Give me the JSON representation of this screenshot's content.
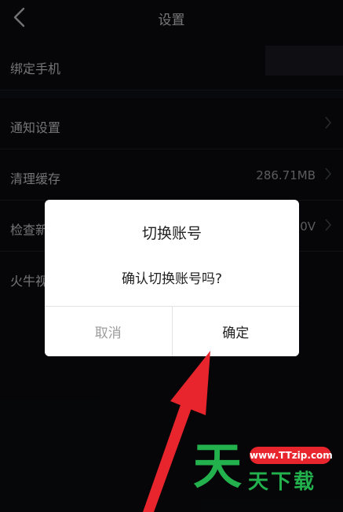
{
  "header": {
    "title": "设置",
    "back_icon": "chevron-left-icon"
  },
  "settings": {
    "items": [
      {
        "label": "绑定手机",
        "value": ""
      },
      {
        "label": "通知设置",
        "value": ""
      },
      {
        "label": "清理缓存",
        "value": "286.71MB"
      },
      {
        "label": "检查新",
        "value": "0V"
      },
      {
        "label": "火牛视",
        "value": ""
      }
    ]
  },
  "dialog": {
    "title": "切换账号",
    "message": "确认切换账号吗?",
    "cancel_label": "取消",
    "confirm_label": "确定"
  },
  "annotation": {
    "arrow_color": "#e8242c"
  },
  "watermark": {
    "big_text": "天",
    "url": "www.TTzip.com",
    "small_text": "天下载",
    "green": "#23b14d",
    "red": "#e8242c"
  },
  "colors": {
    "background": "#0b0c10",
    "dialog_bg": "#ffffff"
  }
}
